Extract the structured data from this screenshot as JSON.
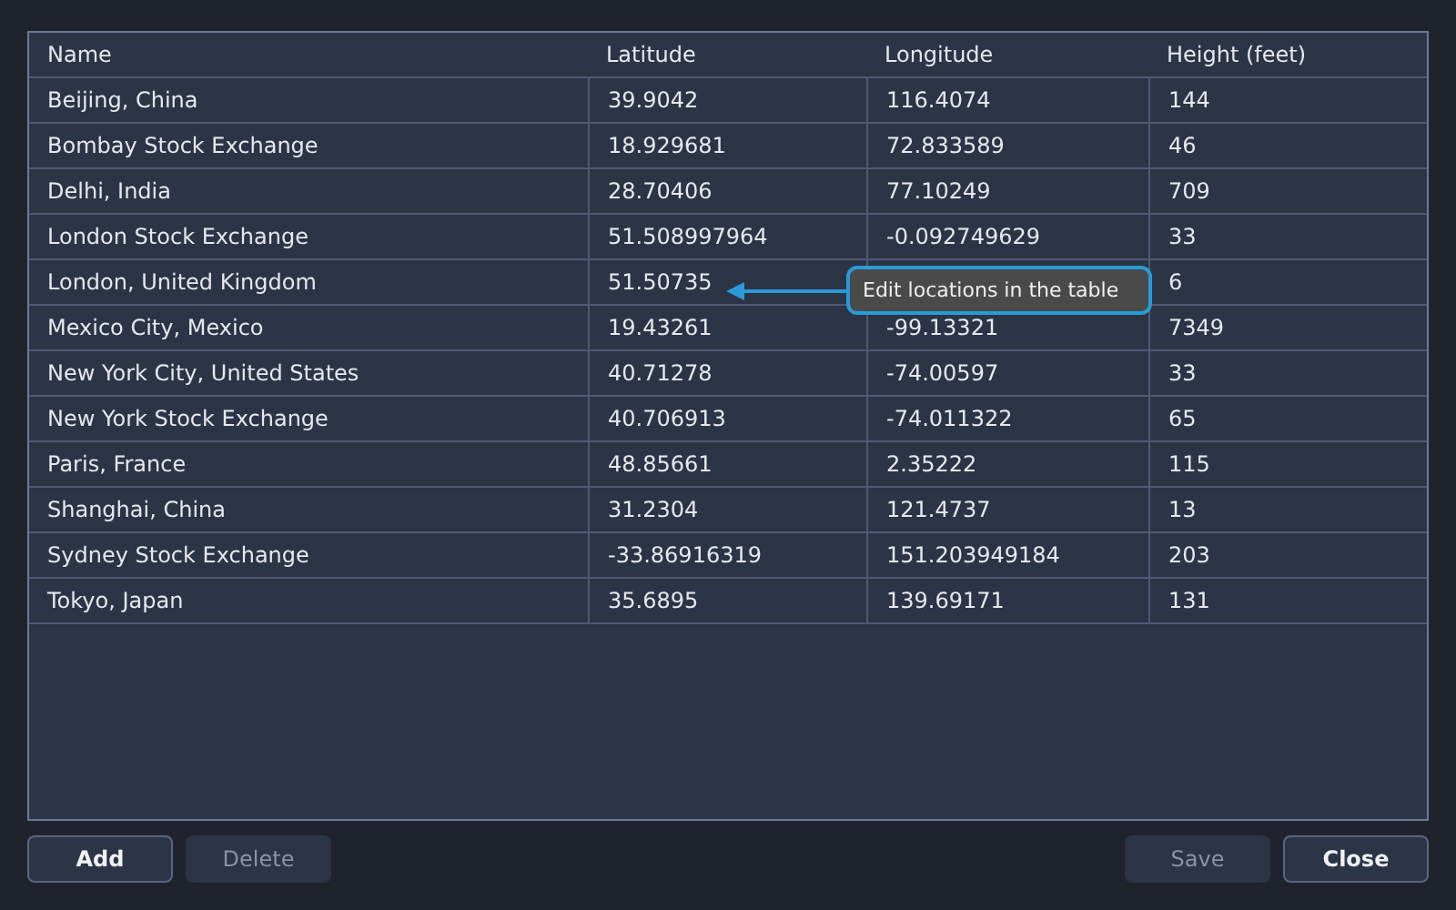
{
  "table": {
    "columns": [
      "Name",
      "Latitude",
      "Longitude",
      "Height (feet)"
    ],
    "rows": [
      [
        "Beijing, China",
        "39.9042",
        "116.4074",
        "144"
      ],
      [
        "Bombay Stock Exchange",
        "18.929681",
        "72.833589",
        "46"
      ],
      [
        "Delhi, India",
        "28.70406",
        "77.10249",
        "709"
      ],
      [
        "London Stock Exchange",
        "51.508997964",
        "-0.092749629",
        "33"
      ],
      [
        "London, United Kingdom",
        "51.50735",
        null,
        "6"
      ],
      [
        "Mexico City, Mexico",
        "19.43261",
        "-99.13321",
        "7349"
      ],
      [
        "New York City, United States",
        "40.71278",
        "-74.00597",
        "33"
      ],
      [
        "New York Stock Exchange",
        "40.706913",
        "-74.011322",
        "65"
      ],
      [
        "Paris, France",
        "48.85661",
        "2.35222",
        "115"
      ],
      [
        "Shanghai, China",
        "31.2304",
        "121.4737",
        "13"
      ],
      [
        "Sydney Stock Exchange",
        "-33.86916319",
        "151.203949184",
        "203"
      ],
      [
        "Tokyo, Japan",
        "35.6895",
        "139.69171",
        "131"
      ]
    ]
  },
  "tooltip": {
    "text": "Edit locations in the table"
  },
  "buttons_left": [
    {
      "label": "Add",
      "disabled": false
    },
    {
      "label": "Delete",
      "disabled": true
    }
  ],
  "buttons_right": [
    {
      "label": "Save",
      "disabled": true
    },
    {
      "label": "Close",
      "disabled": false
    }
  ]
}
